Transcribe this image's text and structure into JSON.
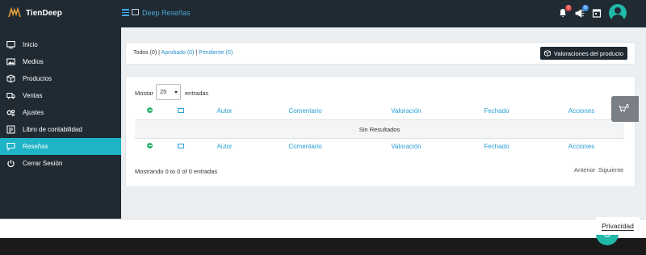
{
  "app": {
    "brand": "TienDeep",
    "page_title": "Deep Reseñas"
  },
  "topbar": {
    "icons": [
      {
        "name": "bell-icon",
        "badge": "0",
        "badge_color": "#e04646"
      },
      {
        "name": "megaphone-icon",
        "badge": "0",
        "badge_color": "#3b8fe8"
      },
      {
        "name": "calendar-icon",
        "badge": null
      }
    ],
    "avatar": "user-avatar"
  },
  "sidebar": {
    "items": [
      {
        "label": "Inicio",
        "icon": "monitor-icon",
        "active": false
      },
      {
        "label": "Medios",
        "icon": "image-icon",
        "active": false
      },
      {
        "label": "Productos",
        "icon": "box-icon",
        "active": false
      },
      {
        "label": "Ventas",
        "icon": "truck-icon",
        "active": false
      },
      {
        "label": "Ajustes",
        "icon": "gears-icon",
        "active": false
      },
      {
        "label": "Libro de contabilidad",
        "icon": "ledger-icon",
        "active": false
      },
      {
        "label": "Reseñas",
        "icon": "comment-icon",
        "active": true
      },
      {
        "label": "Cerrar Sesión",
        "icon": "power-icon",
        "active": false
      }
    ]
  },
  "filters": {
    "all": "Todos (0)",
    "sep": "|",
    "approved": "Aprobado (0)",
    "pending": "Pendiente (0)"
  },
  "product_reviews_button": "Valoraciones del producto",
  "table": {
    "show_label": "Mostar",
    "page_size": "25",
    "entries_label": "entradas",
    "columns": [
      "Autor",
      "Comentario",
      "Valoración",
      "Fechado",
      "Acciones"
    ],
    "empty_text": "Sin Resultados",
    "summary": "Mostrando 0 to 0 of 0 entradas",
    "prev": "Anterior",
    "next": "Siguiente"
  },
  "cart": {
    "count": "0"
  },
  "privacy_label": "Privacidad",
  "colors": {
    "accent": "#1eb3c6",
    "dark": "#1f2a33",
    "link": "#2a9fd6"
  }
}
